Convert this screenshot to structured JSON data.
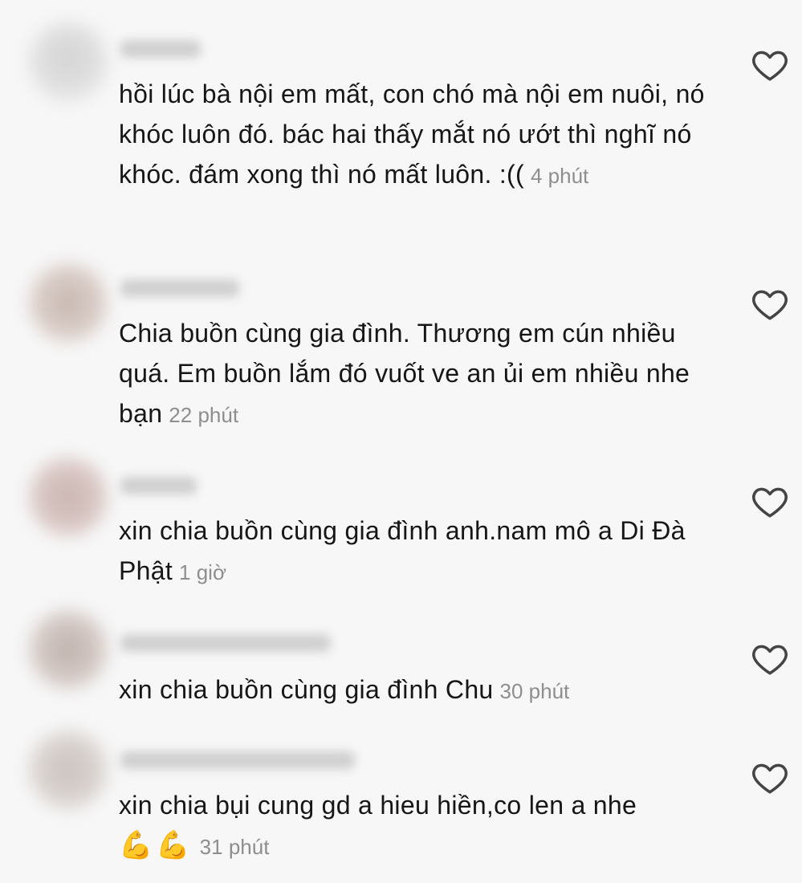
{
  "comments": [
    {
      "text": "hồi lúc bà nội em mất, con chó mà nội em nuôi, nó khóc luôn đó. bác hai thấy mắt nó ướt thì nghĩ nó khóc. đám xong thì nó mất luôn. :((",
      "time": "4 phút"
    },
    {
      "text": "Chia buồn cùng gia đình. Thương em cún nhiều quá. Em buồn lắm đó vuốt ve an ủi em nhiều nhe bạn",
      "time": "22 phút"
    },
    {
      "text": "xin chia buồn cùng gia đình anh.nam mô a Di Đà Phật",
      "time": "1 giờ"
    },
    {
      "text": "xin chia buồn cùng gia đình Chu",
      "time": "30 phút"
    },
    {
      "text": "xin chia bụi cung gd a hieu hiền,co len a nhe",
      "emoji": "💪💪",
      "time": "31 phút"
    }
  ],
  "icons": {
    "like": "heart-outline-icon",
    "emoji": "flexed-biceps"
  },
  "colors": {
    "background": "#f7f7f7",
    "text": "#161616",
    "timestamp": "#8e8e8e"
  }
}
